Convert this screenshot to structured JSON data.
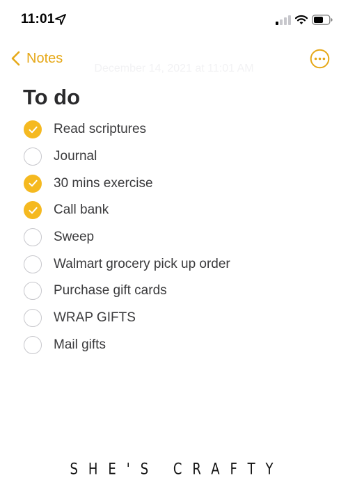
{
  "status_bar": {
    "time": "11:01"
  },
  "nav": {
    "back_label": "Notes",
    "accent_color": "#e6a817"
  },
  "note": {
    "date": "December 14, 2021 at 11:01 AM",
    "title": "To do",
    "items": [
      {
        "text": "Read scriptures",
        "checked": true
      },
      {
        "text": "Journal",
        "checked": false
      },
      {
        "text": "30 mins exercise",
        "checked": true
      },
      {
        "text": "Call bank",
        "checked": true
      },
      {
        "text": "Sweep",
        "checked": false
      },
      {
        "text": "Walmart grocery pick up order",
        "checked": false
      },
      {
        "text": "Purchase gift cards",
        "checked": false
      },
      {
        "text": "WRAP GIFTS",
        "checked": false
      },
      {
        "text": "Mail gifts",
        "checked": false
      }
    ]
  },
  "watermark": "SHE'S CRAFTY",
  "icons": {
    "location": "location-arrow-icon",
    "signal": "cellular-signal-icon",
    "wifi": "wifi-icon",
    "battery": "battery-icon",
    "back": "chevron-left-icon",
    "more": "ellipsis-circle-icon",
    "checked": "checkmark-icon"
  }
}
